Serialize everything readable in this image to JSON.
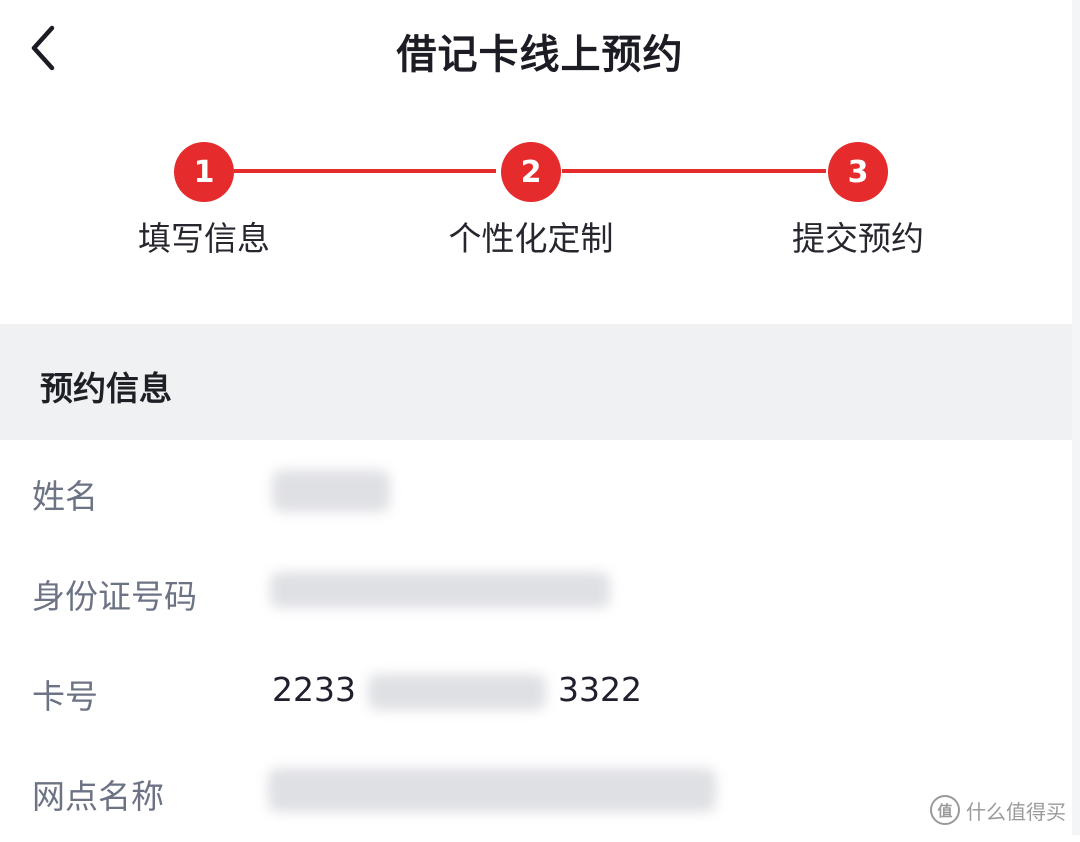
{
  "header": {
    "title": "借记卡线上预约",
    "back_icon": "chevron-left-icon"
  },
  "steps": [
    {
      "number": "1",
      "label": "填写信息"
    },
    {
      "number": "2",
      "label": "个性化定制"
    },
    {
      "number": "3",
      "label": "提交预约"
    }
  ],
  "colors": {
    "accent": "#e52b2b",
    "section_bg": "#f0f1f3",
    "label_gray": "#6c7385"
  },
  "section": {
    "title": "预约信息"
  },
  "fields": {
    "name": {
      "label": "姓名"
    },
    "id_number": {
      "label": "身份证号码"
    },
    "card_number": {
      "label": "卡号",
      "prefix": "2233",
      "suffix": "3322"
    },
    "branch": {
      "label": "网点名称"
    }
  },
  "watermark": {
    "icon": "zhi-icon",
    "icon_text": "值",
    "text": "什么值得买"
  }
}
